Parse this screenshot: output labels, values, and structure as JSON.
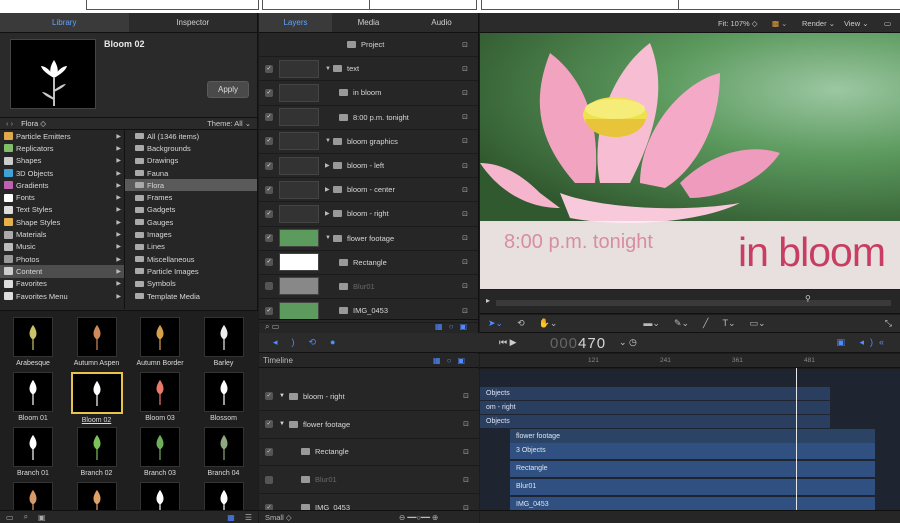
{
  "library": {
    "tabs": [
      "Library",
      "Inspector"
    ],
    "preview_title": "Bloom 02",
    "apply_label": "Apply",
    "breadcrumb": "Flora",
    "theme": "Theme: All",
    "categories": [
      "Particle Emitters",
      "Replicators",
      "Shapes",
      "3D Objects",
      "Gradients",
      "Fonts",
      "Text Styles",
      "Shape Styles",
      "Materials",
      "Music",
      "Photos",
      "Content",
      "Favorites",
      "Favorites Menu"
    ],
    "subitems": [
      "All (1346 items)",
      "Backgrounds",
      "Drawings",
      "Fauna",
      "Flora",
      "Frames",
      "Gadgets",
      "Gauges",
      "Images",
      "Lines",
      "Miscellaneous",
      "Particle Images",
      "Symbols",
      "Template Media"
    ],
    "tiles": [
      "Arabesque",
      "Autumn Aspen",
      "Autumn Border",
      "Barley",
      "Bloom 01",
      "Bloom 02",
      "Bloom 03",
      "Blossom",
      "Branch 01",
      "Branch 02",
      "Branch 03",
      "Branch 04",
      "",
      "",
      "",
      ""
    ]
  },
  "layers": {
    "tabs": [
      "Layers",
      "Media",
      "Audio"
    ],
    "rows": [
      {
        "name": "Project"
      },
      {
        "name": "text"
      },
      {
        "name": "in bloom"
      },
      {
        "name": "8:00 p.m. tonight"
      },
      {
        "name": "bloom graphics"
      },
      {
        "name": "bloom - left"
      },
      {
        "name": "bloom - center"
      },
      {
        "name": "bloom - right"
      },
      {
        "name": "flower footage"
      },
      {
        "name": "Rectangle"
      },
      {
        "name": "Blur01"
      },
      {
        "name": "IMG_0453"
      }
    ]
  },
  "canvas": {
    "fit": "Fit: 107%",
    "render": "Render",
    "view": "View",
    "text_small": "8:00 p.m. tonight",
    "text_large": "in bloom"
  },
  "transport": {
    "timecode_ghost": "000",
    "timecode": "470"
  },
  "timeline": {
    "title": "Timeline",
    "rows": [
      "bloom - right",
      "flower footage",
      "Rectangle",
      "Blur01",
      "IMG_0453"
    ],
    "zoom_label": "Small",
    "ruler": [
      "121",
      "241",
      "361",
      "481"
    ],
    "tracks": [
      "Objects",
      "om - right",
      "Objects",
      "flower footage",
      "3 Objects",
      "Rectangle",
      "Blur01",
      "IMG_0453"
    ]
  }
}
